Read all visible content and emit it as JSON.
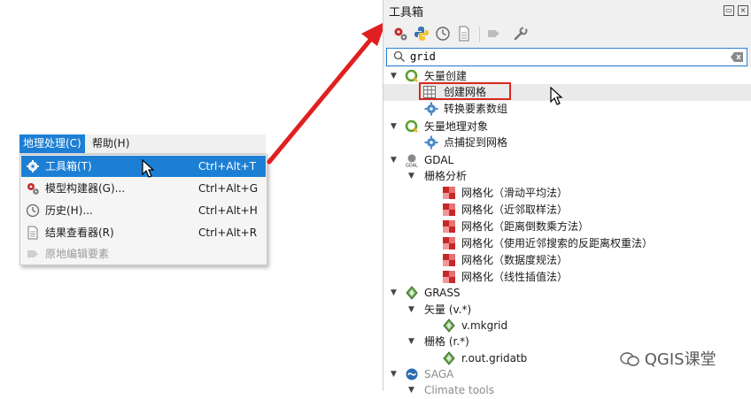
{
  "menubar": {
    "item1": "地理处理(C)",
    "item2": "帮助(H)"
  },
  "menu": {
    "items": [
      {
        "label": "工具箱(T)",
        "shortcut": "Ctrl+Alt+T"
      },
      {
        "label": "模型构建器(G)...",
        "shortcut": "Ctrl+Alt+G"
      },
      {
        "label": "历史(H)...",
        "shortcut": "Ctrl+Alt+H"
      },
      {
        "label": "结果查看器(R)",
        "shortcut": "Ctrl+Alt+R"
      },
      {
        "label": "原地编辑要素",
        "shortcut": ""
      }
    ]
  },
  "panel": {
    "title": "工具箱"
  },
  "search": {
    "value": "grid"
  },
  "tree": {
    "vector_create": "矢量创建",
    "create_grid": "创建网格",
    "convert_array": "转换要素数组",
    "vector_geometry": "矢量地理对象",
    "snap_points": "点捕捉到网格",
    "gdal": "GDAL",
    "raster_analysis": "栅格分析",
    "grid_items": [
      "网格化（滑动平均法）",
      "网格化（近邻取样法）",
      "网格化（距离倒数乘方法）",
      "网格化（使用近邻搜索的反距离权重法）",
      "网格化（数据度规法）",
      "网格化（线性插值法）"
    ],
    "grass": "GRASS",
    "grass_vector": "矢量 (v.*)",
    "v_mkgrid": "v.mkgrid",
    "grass_raster": "栅格 (r.*)",
    "r_out_gridatb": "r.out.gridatb",
    "saga": "SAGA",
    "climate_tools": "Climate tools"
  },
  "watermark": "QGIS课堂",
  "colors": {
    "accent": "#1c7fd4",
    "annotation": "#d8281e"
  }
}
